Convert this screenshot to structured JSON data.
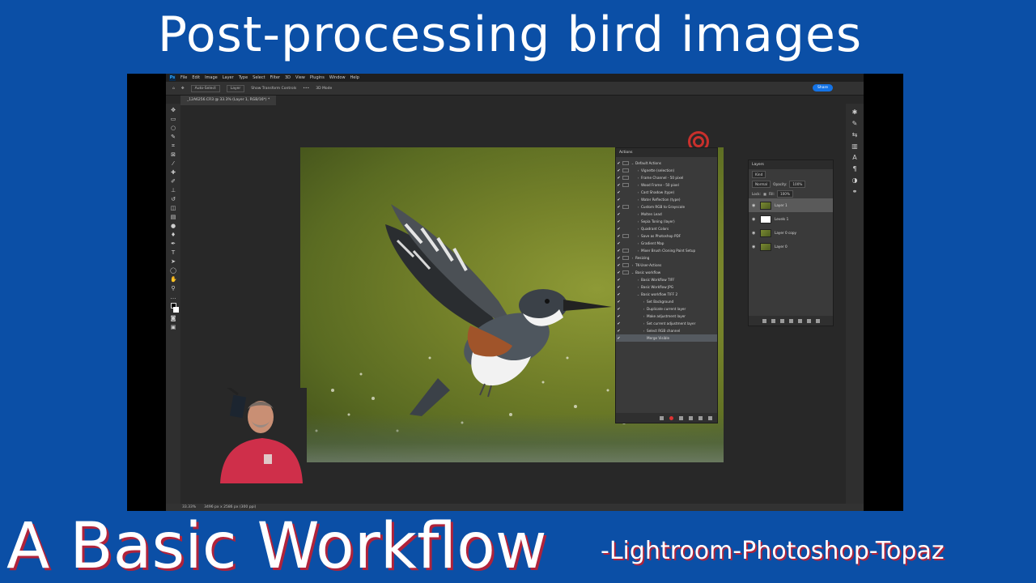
{
  "titles": {
    "top": "Post-processing bird images",
    "bottom": "A Basic Workflow",
    "subtitle": "-Lightroom-Photoshop-Topaz"
  },
  "photoshop": {
    "menu": [
      "File",
      "Edit",
      "Image",
      "Layer",
      "Type",
      "Select",
      "Filter",
      "3D",
      "View",
      "Plugins",
      "Window",
      "Help"
    ],
    "options": {
      "auto_select": "Auto-Select",
      "target": "Layer",
      "transform": "Show Transform Controls",
      "mode": "3D Mode",
      "share": "Share"
    },
    "document_tab": "_12A6256.CR3 @ 33.3% (Layer 1, RGB/16*) *",
    "status": {
      "zoom": "33.33%",
      "size": "3496 px x 2586 px (300 ppi)"
    },
    "actions_panel": {
      "title": "Actions",
      "items": [
        {
          "label": "Default Actions",
          "level": 0,
          "dialog": true,
          "arrow": "v",
          "selected": false
        },
        {
          "label": "Vignette (selection)",
          "level": 1,
          "dialog": true,
          "arrow": ">",
          "selected": false
        },
        {
          "label": "Frame Channel - 50 pixel",
          "level": 1,
          "dialog": true,
          "arrow": ">",
          "selected": false
        },
        {
          "label": "Wood Frame - 50 pixel",
          "level": 1,
          "dialog": true,
          "arrow": ">",
          "selected": false
        },
        {
          "label": "Cast Shadow (type)",
          "level": 1,
          "dialog": false,
          "arrow": ">",
          "selected": false
        },
        {
          "label": "Water Reflection (type)",
          "level": 1,
          "dialog": false,
          "arrow": ">",
          "selected": false
        },
        {
          "label": "Custom RGB to Grayscale",
          "level": 1,
          "dialog": true,
          "arrow": ">",
          "selected": false
        },
        {
          "label": "Molten Lead",
          "level": 1,
          "dialog": false,
          "arrow": ">",
          "selected": false
        },
        {
          "label": "Sepia Toning (layer)",
          "level": 1,
          "dialog": false,
          "arrow": ">",
          "selected": false
        },
        {
          "label": "Quadrant Colors",
          "level": 1,
          "dialog": false,
          "arrow": ">",
          "selected": false
        },
        {
          "label": "Save as Photoshop PDF",
          "level": 1,
          "dialog": true,
          "arrow": ">",
          "selected": false
        },
        {
          "label": "Gradient Map",
          "level": 1,
          "dialog": false,
          "arrow": ">",
          "selected": false
        },
        {
          "label": "Mixer Brush Cloning Paint Setup",
          "level": 1,
          "dialog": true,
          "arrow": ">",
          "selected": false
        },
        {
          "label": "Resizing",
          "level": 0,
          "dialog": true,
          "arrow": ">",
          "selected": false
        },
        {
          "label": "TK-User-Actions",
          "level": 0,
          "dialog": true,
          "arrow": ">",
          "selected": false
        },
        {
          "label": "Basic workflow",
          "level": 0,
          "dialog": true,
          "arrow": "v",
          "selected": false
        },
        {
          "label": "Basic Workflow TIFF",
          "level": 1,
          "dialog": false,
          "arrow": ">",
          "selected": false
        },
        {
          "label": "Basic Workflow JPG",
          "level": 1,
          "dialog": false,
          "arrow": ">",
          "selected": false
        },
        {
          "label": "Basic workflow TIFF 2",
          "level": 1,
          "dialog": false,
          "arrow": "v",
          "selected": false
        },
        {
          "label": "Set Background",
          "level": 2,
          "dialog": false,
          "arrow": ">",
          "selected": false
        },
        {
          "label": "Duplicate current layer",
          "level": 2,
          "dialog": false,
          "arrow": ">",
          "selected": false
        },
        {
          "label": "Make adjustment layer",
          "level": 2,
          "dialog": false,
          "arrow": ">",
          "selected": false
        },
        {
          "label": "Set current adjustment layer",
          "level": 2,
          "dialog": false,
          "arrow": ">",
          "selected": false
        },
        {
          "label": "Select RGB channel",
          "level": 2,
          "dialog": false,
          "arrow": ">",
          "selected": false
        },
        {
          "label": "Merge Visible",
          "level": 2,
          "dialog": false,
          "arrow": "",
          "selected": true
        }
      ]
    },
    "layers_panel": {
      "title": "Layers",
      "filter": "Kind",
      "blend_mode": "Normal",
      "opacity_label": "Opacity:",
      "opacity": "100%",
      "lock_label": "Lock:",
      "fill_label": "Fill:",
      "fill": "100%",
      "layers": [
        {
          "name": "Layer 1",
          "selected": true,
          "thumb": "photo"
        },
        {
          "name": "Levels 1",
          "selected": false,
          "thumb": "white"
        },
        {
          "name": "Layer 0 copy",
          "selected": false,
          "thumb": "photo"
        },
        {
          "name": "Layer 0",
          "selected": false,
          "thumb": "photo"
        }
      ]
    }
  },
  "colors": {
    "background": "#0b4fa6",
    "title_shadow": "#b0233b",
    "ps_canvas": "#282828",
    "accent_share": "#1473e6"
  }
}
